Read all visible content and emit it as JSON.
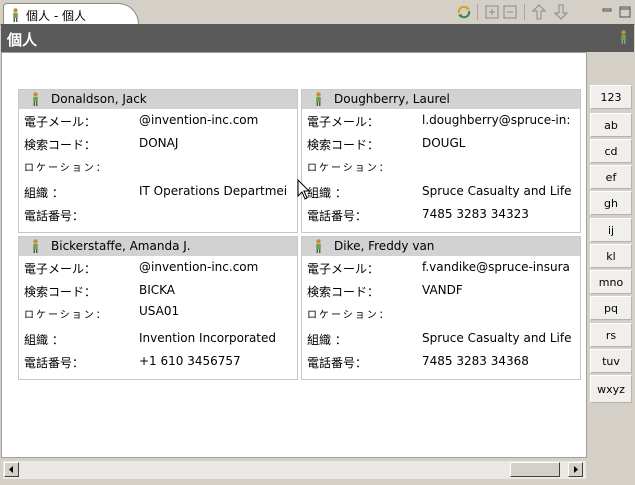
{
  "tab": {
    "title": "個人 - 個人"
  },
  "toolbar": {
    "sync_icon": "sync-icon",
    "expand_icon": "expand-all-icon",
    "collapse_icon": "collapse-all-icon",
    "up_icon": "arrow-up-icon",
    "down_icon": "arrow-down-icon",
    "minimize_icon": "minimize-icon",
    "maximize_icon": "maximize-icon"
  },
  "header": {
    "title": "個人"
  },
  "cards": [
    {
      "name": "Donaldson, Jack",
      "email_label": "電子メール：",
      "email": "@invention-inc.com",
      "search_label": "検索コード：",
      "search": "DONAJ",
      "location_label": "ロケーション：",
      "location": "",
      "org_label": "組織 ：",
      "org": "IT Operations Departmei",
      "phone_label": "電話番号：",
      "phone": ""
    },
    {
      "name": "Doughberry, Laurel",
      "email_label": "電子メール：",
      "email": "l.doughberry@spruce-in:",
      "search_label": "検索コード：",
      "search": "DOUGL",
      "location_label": "ロケーション：",
      "location": "",
      "org_label": "組織 ：",
      "org": "Spruce Casualty and Life",
      "phone_label": "電話番号：",
      "phone": "7485 3283 34323"
    },
    {
      "name": "Bickerstaffe, Amanda J.",
      "email_label": "電子メール：",
      "email": "@invention-inc.com",
      "search_label": "検索コード：",
      "search": "BICKA",
      "location_label": "ロケーション：",
      "location": "USA01",
      "org_label": "組織 ：",
      "org": "Invention Incorporated",
      "phone_label": "電話番号：",
      "phone": "+1 610 3456757"
    },
    {
      "name": "Dike, Freddy van",
      "email_label": "電子メール：",
      "email": "f.vandike@spruce-insura",
      "search_label": "検索コード：",
      "search": "VANDF",
      "location_label": "ロケーション：",
      "location": "",
      "org_label": "組織 ：",
      "org": "Spruce Casualty and Life",
      "phone_label": "電話番号：",
      "phone": "7485 3283 34368"
    }
  ],
  "index": [
    "123",
    "ab",
    "cd",
    "ef",
    "gh",
    "ij",
    "kl",
    "mno",
    "pq",
    "rs",
    "tuv",
    "wxyz"
  ],
  "colors": {
    "header_bg": "#5a5a5a",
    "card_header_bg": "#d2d2d2",
    "window_bg": "#d4d0c8"
  }
}
